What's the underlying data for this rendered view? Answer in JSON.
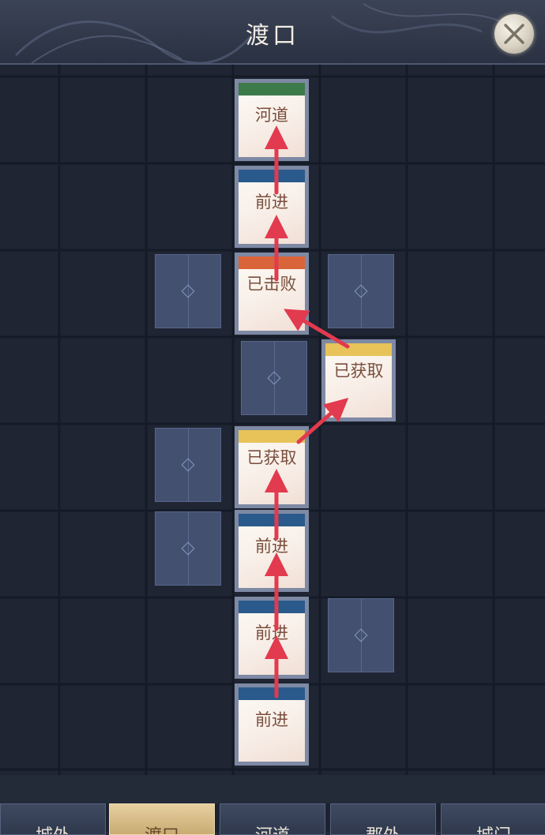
{
  "header": {
    "title": "渡口"
  },
  "board": {
    "nodes": [
      {
        "label": "河道",
        "bar_color": "#3d7a4a"
      },
      {
        "label": "前进",
        "bar_color": "#2a5a8c"
      },
      {
        "label": "已击败",
        "bar_color": "#d9643a"
      },
      {
        "label": "已获取",
        "bar_color": "#e8c35a"
      },
      {
        "label": "已获取",
        "bar_color": "#e8c35a"
      },
      {
        "label": "前进",
        "bar_color": "#2a5a8c"
      },
      {
        "label": "前进",
        "bar_color": "#2a5a8c"
      },
      {
        "label": "前进",
        "bar_color": "#2a5a8c"
      }
    ],
    "path_arrow_color": "#e23a4e"
  },
  "tabs": [
    {
      "label": "城外"
    },
    {
      "label": "渡口"
    },
    {
      "label": "河道"
    },
    {
      "label": "郡外"
    },
    {
      "label": "城门"
    }
  ],
  "colors": {
    "accent": "#e8c35a",
    "background": "#232a38"
  }
}
